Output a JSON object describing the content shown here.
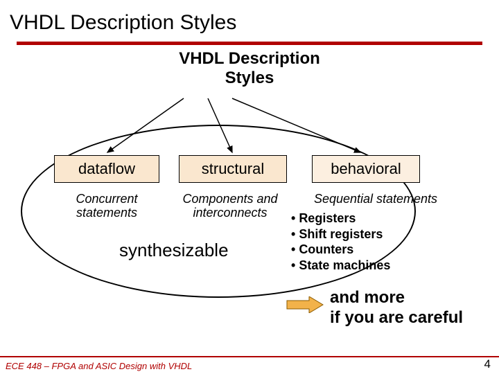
{
  "title": "VHDL Description Styles",
  "subtitle_line1": "VHDL Description",
  "subtitle_line2": "Styles",
  "boxes": {
    "dataflow": "dataflow",
    "structural": "structural",
    "behavioral": "behavioral"
  },
  "descriptions": {
    "dataflow_line1": "Concurrent",
    "dataflow_line2": "statements",
    "structural_line1": "Components and",
    "structural_line2": "interconnects",
    "behavioral": "Sequential statements"
  },
  "bullets": {
    "b1": "Registers",
    "b2": "Shift registers",
    "b3": "Counters",
    "b4": "State machines"
  },
  "synthesizable": "synthesizable",
  "note_line1": "and more",
  "note_line2": "if you are careful",
  "footer": {
    "left": "ECE 448 – FPGA and ASIC Design with VHDL",
    "right": "4"
  },
  "colors": {
    "accent": "#b00000",
    "box_fill": "#fae7cf",
    "box_fill_light": "#fcefe0"
  }
}
